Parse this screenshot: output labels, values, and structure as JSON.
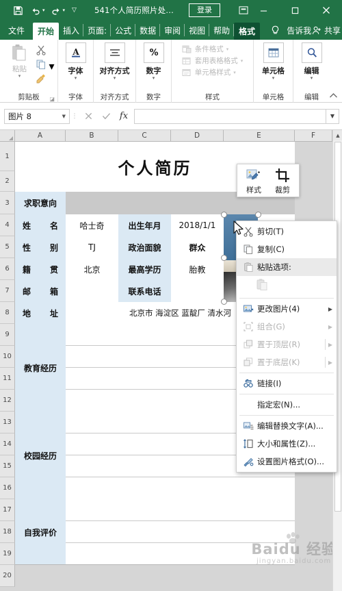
{
  "titlebar": {
    "document_title": "541个人简历照片处...",
    "signin_label": "登录",
    "quick_access": [
      {
        "name": "save",
        "icon": "save-icon"
      },
      {
        "name": "undo",
        "icon": "undo-icon"
      },
      {
        "name": "redo",
        "icon": "redo-icon"
      },
      {
        "name": "customize",
        "icon": "chevron-down-icon"
      }
    ],
    "ribbon_display_icon": "ribbon-display-options-icon",
    "window_controls": [
      {
        "name": "minimize",
        "glyph": "—"
      },
      {
        "name": "maximize",
        "glyph": "□"
      },
      {
        "name": "close",
        "glyph": "✕"
      }
    ],
    "accent_color": "#217346"
  },
  "tabs": [
    {
      "label": "文件",
      "state": "file"
    },
    {
      "label": "开始",
      "state": "active"
    },
    {
      "label": "插入",
      "state": "normal"
    },
    {
      "label": "页面:",
      "state": "normal"
    },
    {
      "label": "公式",
      "state": "normal"
    },
    {
      "label": "数据",
      "state": "normal"
    },
    {
      "label": "审阅",
      "state": "normal"
    },
    {
      "label": "视图",
      "state": "normal"
    },
    {
      "label": "帮助",
      "state": "normal"
    },
    {
      "label": "格式",
      "state": "contextual"
    }
  ],
  "tellme": {
    "label": "告诉我",
    "icon": "lightbulb-icon"
  },
  "share": {
    "label": "共享",
    "icon": "person-share-icon"
  },
  "ribbon": {
    "groups": [
      {
        "name": "clipboard",
        "label": "剪贴板",
        "paste_label": "粘贴",
        "items": [
          {
            "label": "剪切",
            "icon": "scissors-icon"
          },
          {
            "label": "复制",
            "icon": "copy-icon"
          },
          {
            "label": "格式刷",
            "icon": "format-painter-icon"
          }
        ],
        "has_launcher": true
      },
      {
        "name": "font",
        "label": "字体",
        "button": "字体",
        "icon": "font-A-icon"
      },
      {
        "name": "alignment",
        "label": "对齐方式",
        "button": "对齐方式",
        "icon": "align-center-icon"
      },
      {
        "name": "number",
        "label": "数字",
        "button": "数字",
        "icon": "percent-icon"
      },
      {
        "name": "styles",
        "label": "样式",
        "items": [
          {
            "label": "条件格式",
            "icon": "conditional-format-icon",
            "disabled": true
          },
          {
            "label": "套用表格格式",
            "icon": "table-style-icon",
            "disabled": true
          },
          {
            "label": "单元格样式",
            "icon": "cell-style-icon",
            "disabled": true
          }
        ]
      },
      {
        "name": "cells",
        "label": "单元格",
        "button": "单元格",
        "icon": "cells-icon"
      },
      {
        "name": "editing",
        "label": "编辑",
        "button": "编辑",
        "icon": "magnifier-icon"
      }
    ],
    "collapse_icon": "collapse-ribbon-icon"
  },
  "formula_bar": {
    "name_box_value": "图片 8",
    "cancel_icon": "cancel-x-icon",
    "confirm_icon": "confirm-check-icon",
    "function_icon": "fx-icon",
    "formula_value": "",
    "expand_icon": "chevron-down-icon"
  },
  "grid": {
    "columns": [
      "A",
      "B",
      "C",
      "D",
      "E",
      "F"
    ],
    "rows": [
      "1",
      "2",
      "3",
      "4",
      "5",
      "6",
      "7",
      "8",
      "9",
      "10",
      "11",
      "12",
      "13",
      "14",
      "15",
      "16",
      "17",
      "18",
      "19",
      "20"
    ],
    "title_cell": "个人简历",
    "fields": [
      {
        "label": "求职意向",
        "value": ""
      },
      {
        "label": "姓　名",
        "value": "哈士奇",
        "label2": "出生年月",
        "value2": "2018/1/1"
      },
      {
        "label": "性　别",
        "value": "TJ",
        "label2": "政治面貌",
        "value2": "群众"
      },
      {
        "label": "籍　贯",
        "value": "北京",
        "label2": "最高学历",
        "value2": "胎教"
      },
      {
        "label": "邮　箱",
        "value": "",
        "label2": "联系电话",
        "value2": ""
      },
      {
        "label": "地　址",
        "value": "北京市 海淀区 蓝靛厂 清水河"
      }
    ],
    "sections": [
      {
        "label": "教育经历"
      },
      {
        "label": "校园经历"
      },
      {
        "label": "自我评价"
      }
    ]
  },
  "picture": {
    "name": "图片 8",
    "selected": true,
    "handles": 8
  },
  "mini_toolbar": {
    "items": [
      {
        "label": "样式",
        "icon": "picture-style-icon",
        "has_dropdown": true
      },
      {
        "label": "裁剪",
        "icon": "crop-icon",
        "has_dropdown": false
      }
    ]
  },
  "context_menu": {
    "items": [
      {
        "label": "剪切(T)",
        "icon": "scissors-icon",
        "disabled": false,
        "submenu": false,
        "highlighted": false
      },
      {
        "label": "复制(C)",
        "icon": "copy-icon",
        "disabled": false,
        "submenu": false,
        "highlighted": false
      },
      {
        "label": "粘贴选项:",
        "icon": "paste-icon",
        "disabled": false,
        "submenu": false,
        "highlighted": true
      },
      {
        "label": "更改图片(4)",
        "icon": "change-picture-icon",
        "disabled": false,
        "submenu": true,
        "highlighted": false
      },
      {
        "label": "组合(G)",
        "icon": "group-icon",
        "disabled": true,
        "submenu": true,
        "highlighted": false
      },
      {
        "label": "置于顶层(R)",
        "icon": "bring-to-front-icon",
        "disabled": true,
        "submenu": true,
        "highlighted": false
      },
      {
        "label": "置于底层(K)",
        "icon": "send-to-back-icon",
        "disabled": true,
        "submenu": true,
        "highlighted": false
      },
      {
        "label": "链接(I)",
        "icon": "link-icon",
        "disabled": false,
        "submenu": false,
        "highlighted": false
      },
      {
        "label": "指定宏(N)...",
        "icon": "macro-icon",
        "disabled": false,
        "submenu": false,
        "highlighted": false
      },
      {
        "label": "编辑替换文字(A)...",
        "icon": "alt-text-icon",
        "disabled": false,
        "submenu": false,
        "highlighted": false
      },
      {
        "label": "大小和属性(Z)...",
        "icon": "size-properties-icon",
        "disabled": false,
        "submenu": false,
        "highlighted": false
      },
      {
        "label": "设置图片格式(O)...",
        "icon": "format-picture-icon",
        "disabled": false,
        "submenu": false,
        "highlighted": false
      }
    ],
    "paste_option_icon": "paste-disabled-icon"
  },
  "watermark": {
    "main": "Baidu 经验",
    "sub": "jingyan.baidu.com"
  },
  "scrollbar": {
    "up_icon": "scroll-up-icon"
  }
}
